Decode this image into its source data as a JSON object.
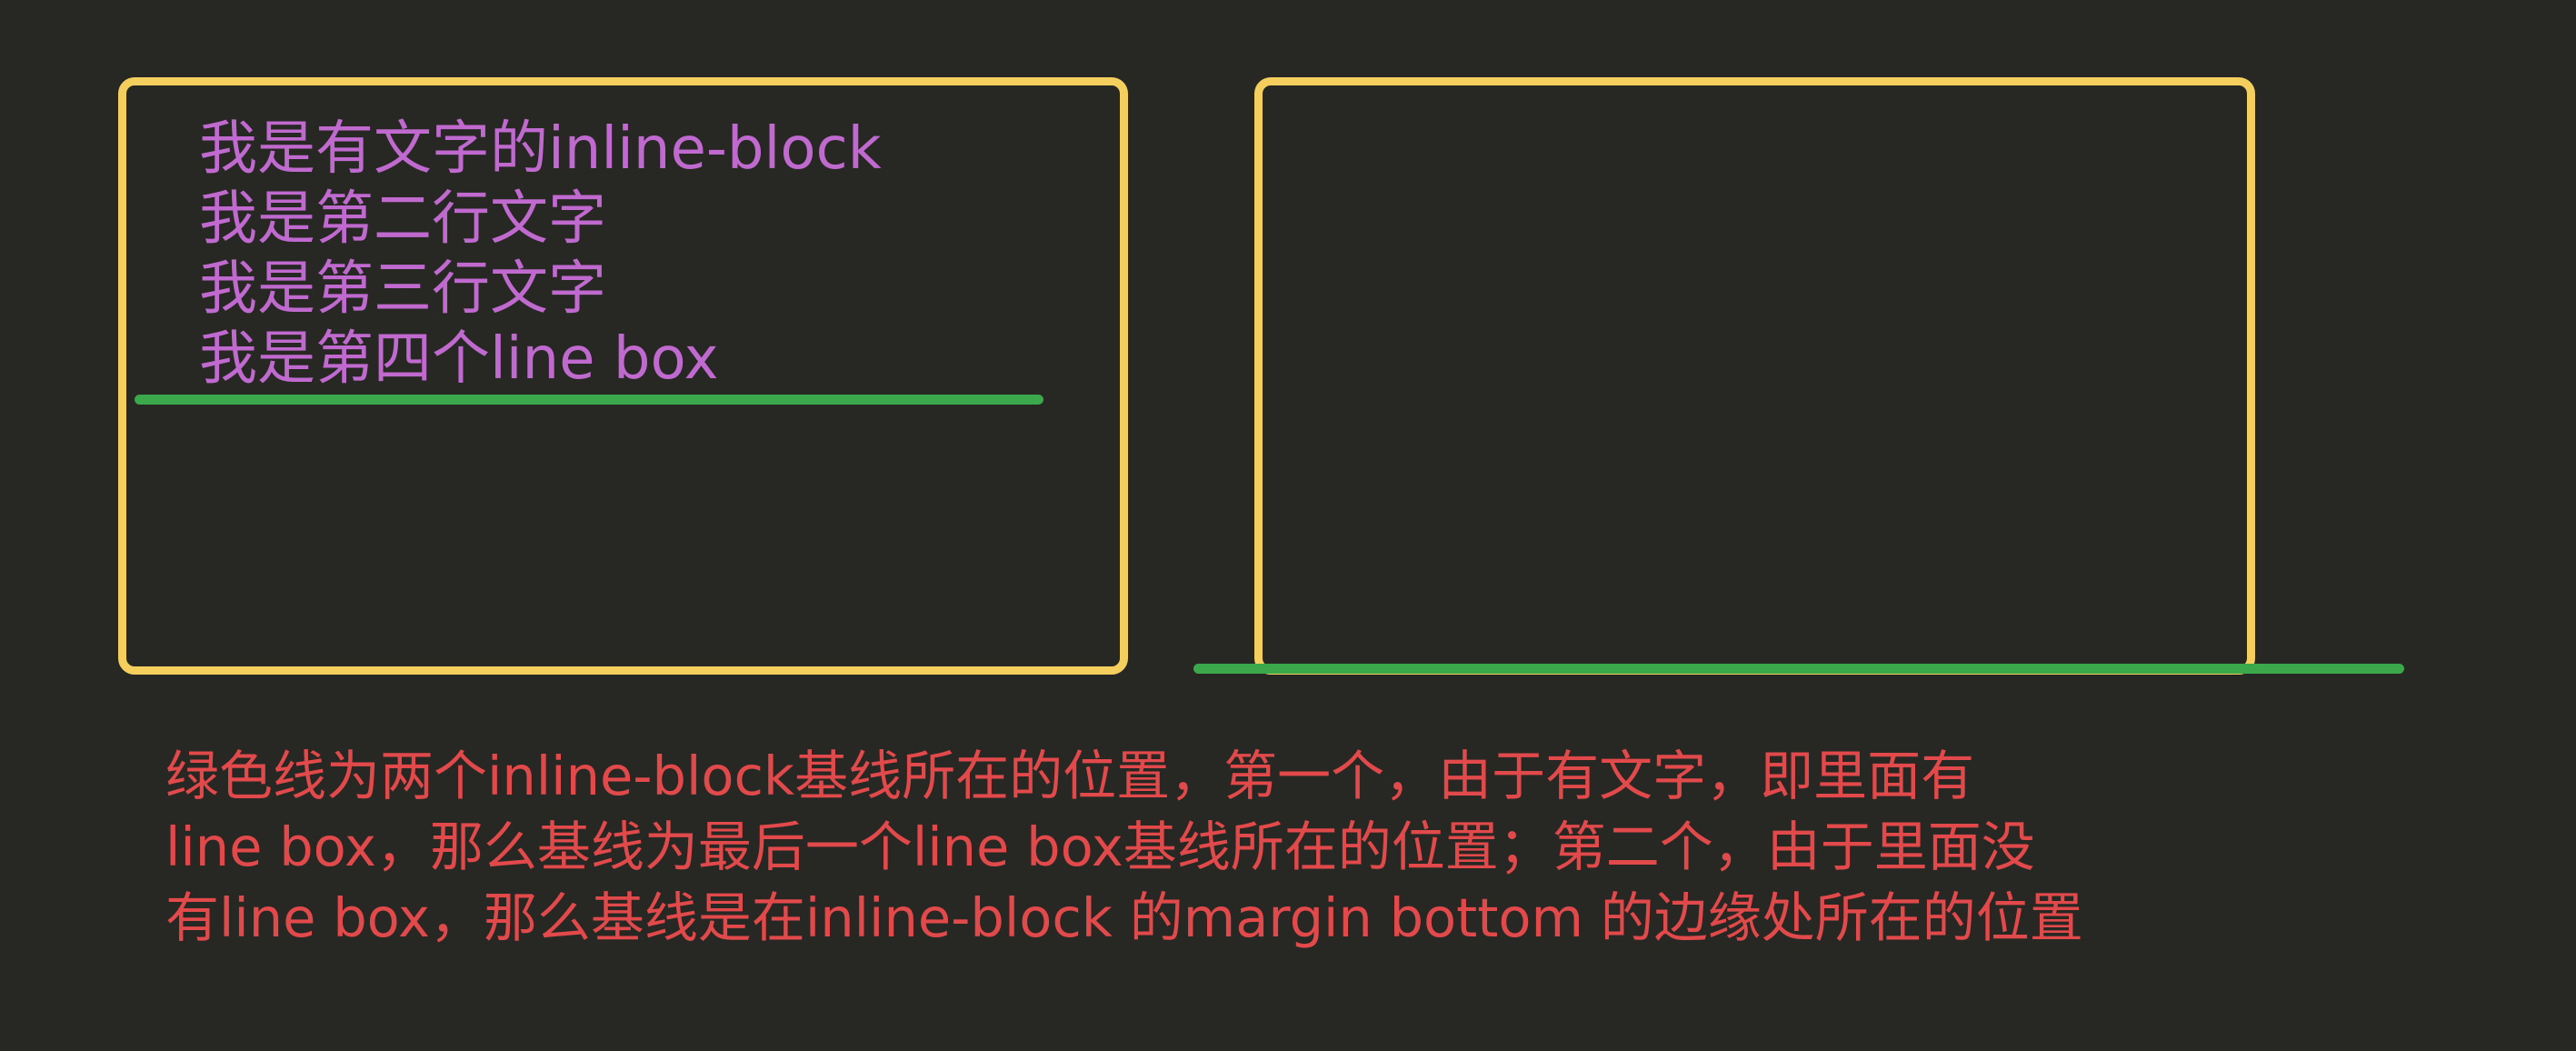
{
  "left_box": {
    "lines": [
      "我是有文字的inline-block",
      "我是第二行文字",
      "我是第三行文字",
      "我是第四个line box"
    ]
  },
  "caption": {
    "lines": [
      "绿色线为两个inline-block基线所在的位置，第一个，由于有文字，即里面有",
      "line box，那么基线为最后一个line box基线所在的位置；第二个，由于里面没",
      "有line box，那么基线是在inline-block 的margin bottom 的边缘处所在的位置"
    ]
  },
  "colors": {
    "background": "#272723",
    "box_border": "#f4cf5d",
    "inline_text": "#c06ad0",
    "baseline": "#3aa84b",
    "caption_text": "#e2494b"
  }
}
